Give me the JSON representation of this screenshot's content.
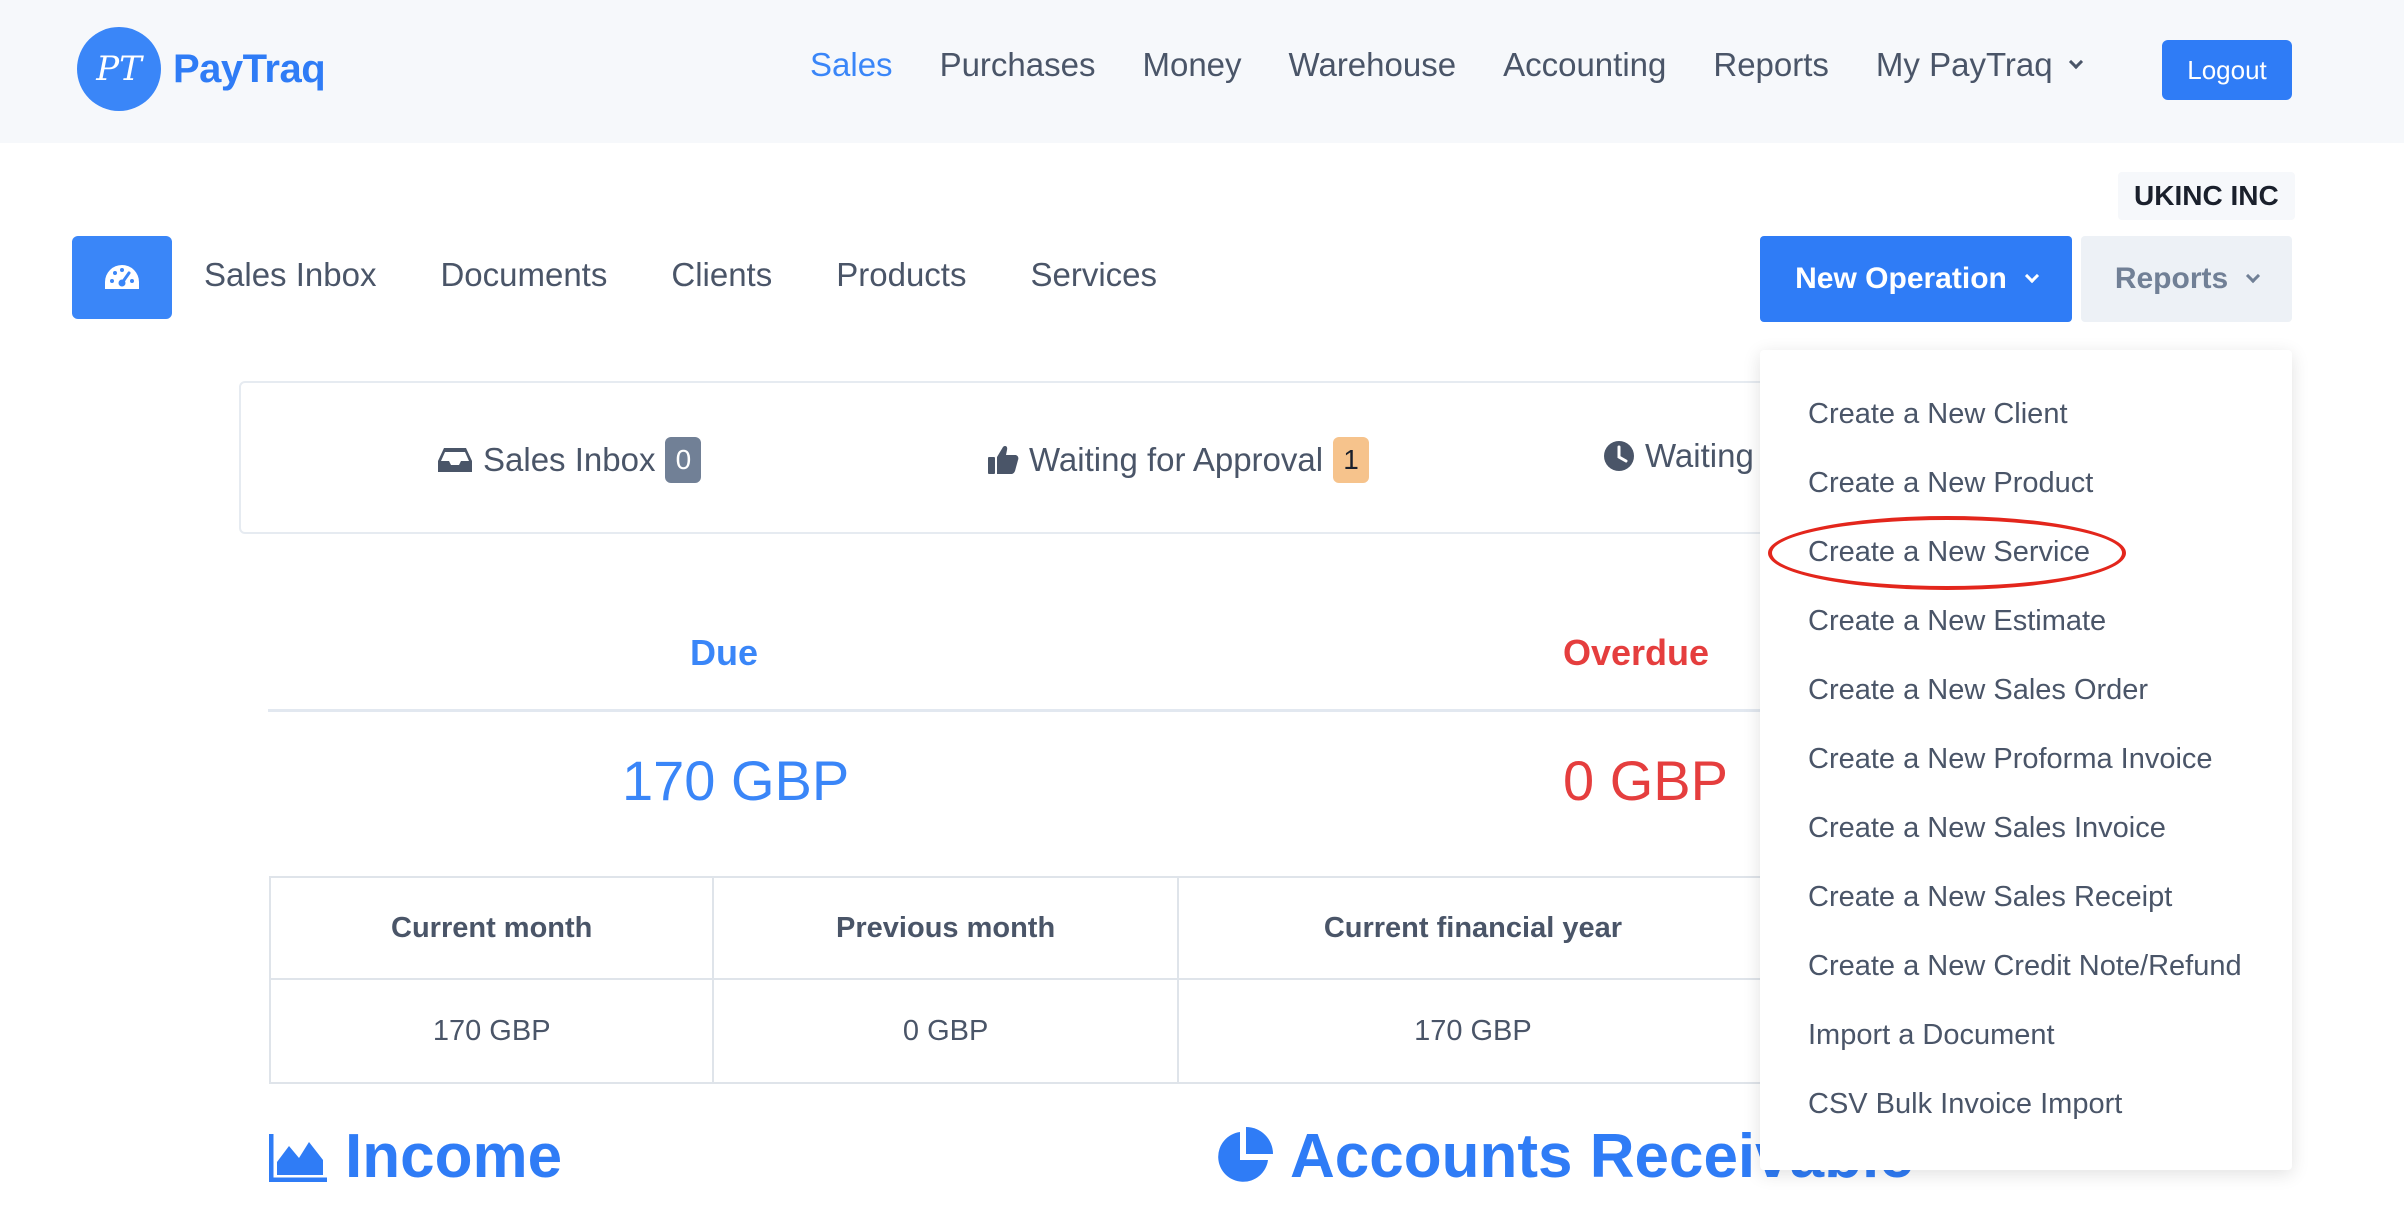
{
  "app": {
    "name": "PayTraq",
    "logo_initials": "PT"
  },
  "topnav": {
    "items": [
      {
        "label": "Sales",
        "active": true
      },
      {
        "label": "Purchases",
        "active": false
      },
      {
        "label": "Money",
        "active": false
      },
      {
        "label": "Warehouse",
        "active": false
      },
      {
        "label": "Accounting",
        "active": false
      },
      {
        "label": "Reports",
        "active": false
      },
      {
        "label": "My PayTraq",
        "active": false,
        "has_dropdown": true
      }
    ],
    "logout_label": "Logout"
  },
  "company": {
    "name": "UKINC INC"
  },
  "subnav": {
    "items": [
      "Sales Inbox",
      "Documents",
      "Clients",
      "Products",
      "Services"
    ],
    "new_operation_label": "New Operation",
    "reports_label": "Reports"
  },
  "status": {
    "sales_inbox": {
      "label": "Sales Inbox",
      "count": "0"
    },
    "waiting_approval": {
      "label": "Waiting for Approval",
      "count": "1"
    },
    "waiting": {
      "label": "Waiting"
    }
  },
  "amounts": {
    "due_label": "Due",
    "due_value": "170 GBP",
    "overdue_label": "Overdue",
    "overdue_value": "0 GBP"
  },
  "summary_table": {
    "headers": [
      "Current month",
      "Previous month",
      "Current financial year"
    ],
    "values": [
      "170 GBP",
      "0 GBP",
      "170 GBP"
    ]
  },
  "sections": {
    "income": "Income",
    "accounts_receivable": "Accounts Receivable"
  },
  "dropdown": {
    "items": [
      "Create a New Client",
      "Create a New Product",
      "Create a New Service",
      "Create a New Estimate",
      "Create a New Sales Order",
      "Create a New Proforma Invoice",
      "Create a New Sales Invoice",
      "Create a New Sales Receipt",
      "Create a New Credit Note/Refund",
      "Import a Document",
      "CSV Bulk Invoice Import"
    ],
    "highlighted": "Create a New Service"
  },
  "colors": {
    "brand": "#2f7cf6",
    "accent": "#3a86f8",
    "danger": "#e53e3e",
    "warning_badge": "#f6c38c",
    "annotation": "#e3261c"
  }
}
